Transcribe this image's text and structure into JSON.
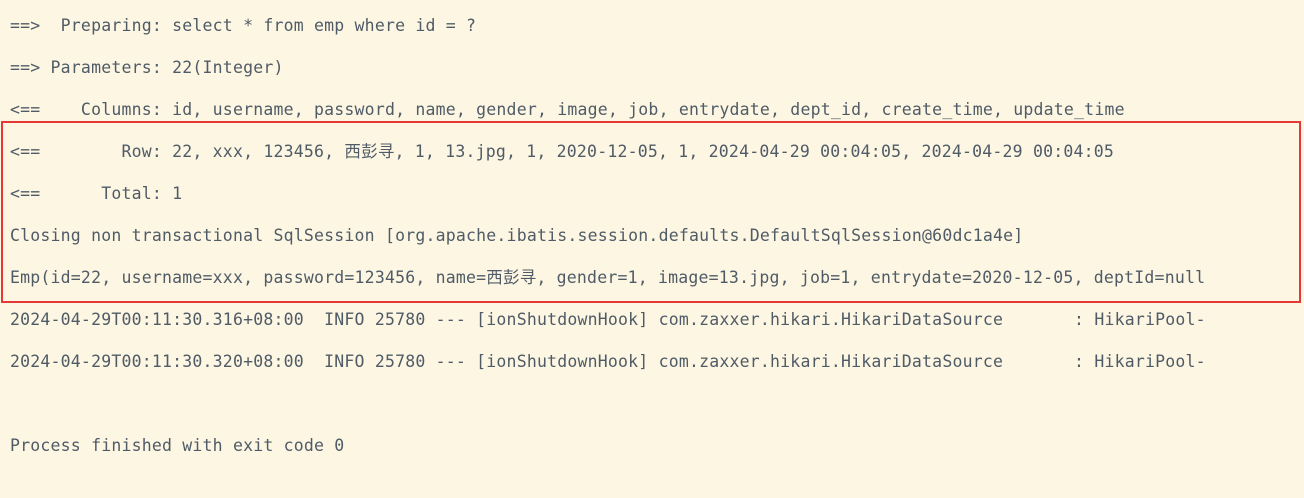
{
  "console": {
    "lines": [
      "==>  Preparing: select * from emp where id = ?",
      "==> Parameters: 22(Integer)",
      "<==    Columns: id, username, password, name, gender, image, job, entrydate, dept_id, create_time, update_time",
      "<==        Row: 22, xxx, 123456, 西彭寻, 1, 13.jpg, 1, 2020-12-05, 1, 2024-04-29 00:04:05, 2024-04-29 00:04:05",
      "<==      Total: 1",
      "Closing non transactional SqlSession [org.apache.ibatis.session.defaults.DefaultSqlSession@60dc1a4e]",
      "Emp(id=22, username=xxx, password=123456, name=西彭寻, gender=1, image=13.jpg, job=1, entrydate=2020-12-05, deptId=null",
      "2024-04-29T00:11:30.316+08:00  INFO 25780 --- [ionShutdownHook] com.zaxxer.hikari.HikariDataSource       : HikariPool-",
      "2024-04-29T00:11:30.320+08:00  INFO 25780 --- [ionShutdownHook] com.zaxxer.hikari.HikariDataSource       : HikariPool-",
      "Process finished with exit code 0"
    ]
  },
  "colors": {
    "background": "#fdf6e3",
    "text": "#4f5b66",
    "highlight_border": "#e53935"
  }
}
